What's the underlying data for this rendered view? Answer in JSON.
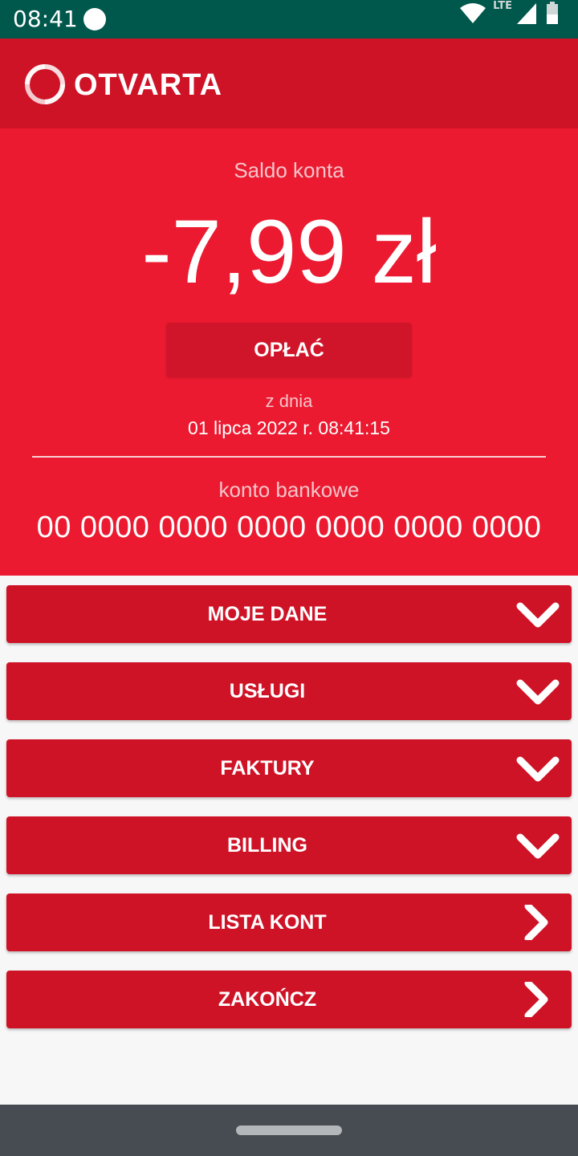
{
  "status_bar": {
    "time": "08:41",
    "network": "LTE"
  },
  "header": {
    "brand": "OTVARTA",
    "logo_icon": "otvarta-logo-icon"
  },
  "balance": {
    "label": "Saldo konta",
    "amount": "-7,99 zł",
    "pay_button": "OPŁAĆ",
    "date_label": "z dnia",
    "date_value": "01 lipca 2022 r. 08:41:15",
    "account_label": "konto bankowe",
    "account_number": "00 0000 0000 0000 0000 0000 0000"
  },
  "menu": {
    "items": [
      {
        "label": "MOJE DANE",
        "icon": "chevron-down-icon"
      },
      {
        "label": "USŁUGI",
        "icon": "chevron-down-icon"
      },
      {
        "label": "FAKTURY",
        "icon": "chevron-down-icon"
      },
      {
        "label": "BILLING",
        "icon": "chevron-down-icon"
      },
      {
        "label": "LISTA KONT",
        "icon": "chevron-right-icon"
      },
      {
        "label": "ZAKOŃCZ",
        "icon": "chevron-right-icon"
      }
    ]
  },
  "colors": {
    "status_bar": "#00574b",
    "header": "#cf1327",
    "panel": "#eb1a30",
    "menu_item": "#cf1327",
    "nav_bar": "#474c52"
  }
}
